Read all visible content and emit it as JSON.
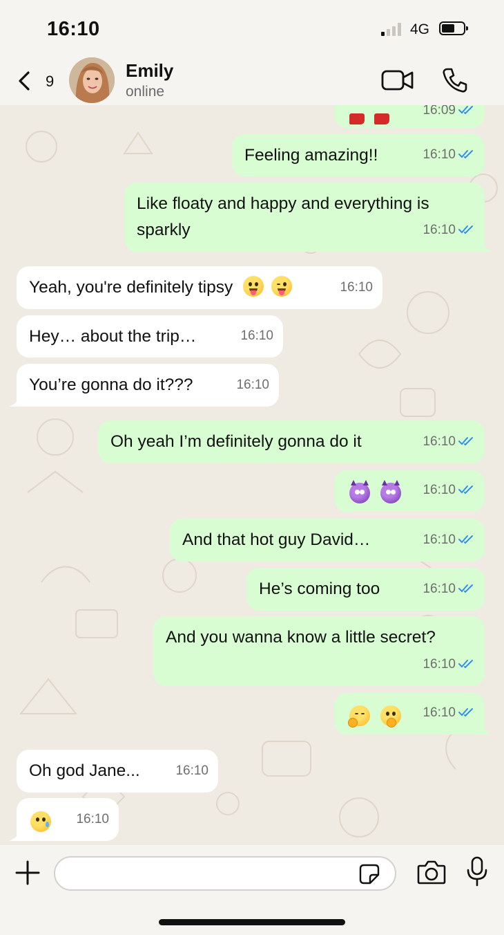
{
  "status_bar": {
    "time": "16:10",
    "network": "4G"
  },
  "header": {
    "back_count": "9",
    "contact_name": "Emily",
    "contact_status": "online"
  },
  "icons": {
    "back": "chevron-left-icon",
    "video": "video-camera-icon",
    "call": "phone-icon",
    "plus": "plus-icon",
    "sticker": "sticker-icon",
    "camera": "camera-icon",
    "mic": "microphone-icon"
  },
  "colors": {
    "outgoing_bubble": "#d9fdd3",
    "incoming_bubble": "#ffffff",
    "read_check": "#2f8ff0",
    "background": "#efeae2"
  },
  "messages": [
    {
      "direction": "out",
      "text": "",
      "emoji": [
        "boots",
        "boots"
      ],
      "time": "16:09",
      "read": true
    },
    {
      "direction": "out",
      "text": "Feeling amazing!!",
      "time": "16:10",
      "read": true
    },
    {
      "direction": "out",
      "text": "Like floaty and happy and everything is sparkly",
      "time": "16:10",
      "read": true
    },
    {
      "direction": "in",
      "text": "Yeah, you're definitely tipsy",
      "emoji": [
        "face-with-tongue",
        "winking-face-with-tongue"
      ],
      "time": "16:10"
    },
    {
      "direction": "in",
      "text": "Hey… about the trip…",
      "time": "16:10"
    },
    {
      "direction": "in",
      "text": "You’re gonna do it???",
      "time": "16:10"
    },
    {
      "direction": "out",
      "text": "Oh yeah I’m definitely gonna do it",
      "time": "16:10",
      "read": true
    },
    {
      "direction": "out",
      "text": "",
      "emoji": [
        "smiling-face-with-horns",
        "smiling-face-with-horns"
      ],
      "time": "16:10",
      "read": true
    },
    {
      "direction": "out",
      "text": "And that hot guy David…",
      "time": "16:10",
      "read": true
    },
    {
      "direction": "out",
      "text": "He’s coming too",
      "time": "16:10",
      "read": true
    },
    {
      "direction": "out",
      "text": "And you wanna know a little secret?",
      "time": "16:10",
      "read": true
    },
    {
      "direction": "out",
      "text": "",
      "emoji": [
        "face-with-hand-over-mouth",
        "face-with-open-eyes-and-hand-over-mouth"
      ],
      "time": "16:10",
      "read": true
    },
    {
      "direction": "in",
      "text": "Oh god Jane...",
      "time": "16:10"
    },
    {
      "direction": "in",
      "text": "",
      "emoji": [
        "face-holding-back-tears"
      ],
      "time": "16:10"
    }
  ],
  "composer": {
    "placeholder": ""
  }
}
